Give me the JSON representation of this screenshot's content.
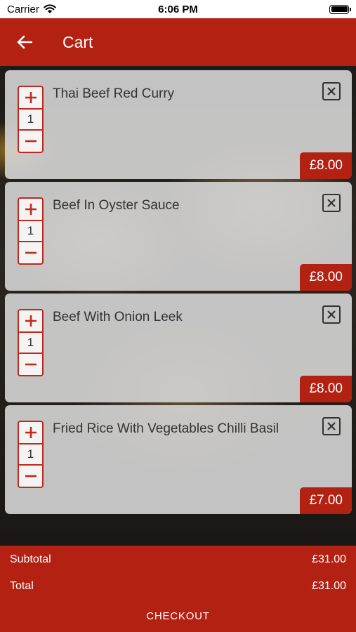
{
  "status_bar": {
    "carrier": "Carrier",
    "time": "6:06 PM"
  },
  "header": {
    "title": "Cart"
  },
  "cart": {
    "items": [
      {
        "name": "Thai Beef Red Curry",
        "quantity": "1",
        "price": "£8.00"
      },
      {
        "name": "Beef In Oyster Sauce",
        "quantity": "1",
        "price": "£8.00"
      },
      {
        "name": "Beef With Onion Leek",
        "quantity": "1",
        "price": "£8.00"
      },
      {
        "name": "Fried Rice With Vegetables Chilli Basil",
        "quantity": "1",
        "price": "£7.00"
      }
    ]
  },
  "summary": {
    "subtotal_label": "Subtotal",
    "subtotal_value": "£31.00",
    "total_label": "Total",
    "total_value": "£31.00",
    "checkout_label": "CHECKOUT"
  },
  "colors": {
    "brand_red": "#b32112",
    "accent_red": "#c0291b"
  }
}
